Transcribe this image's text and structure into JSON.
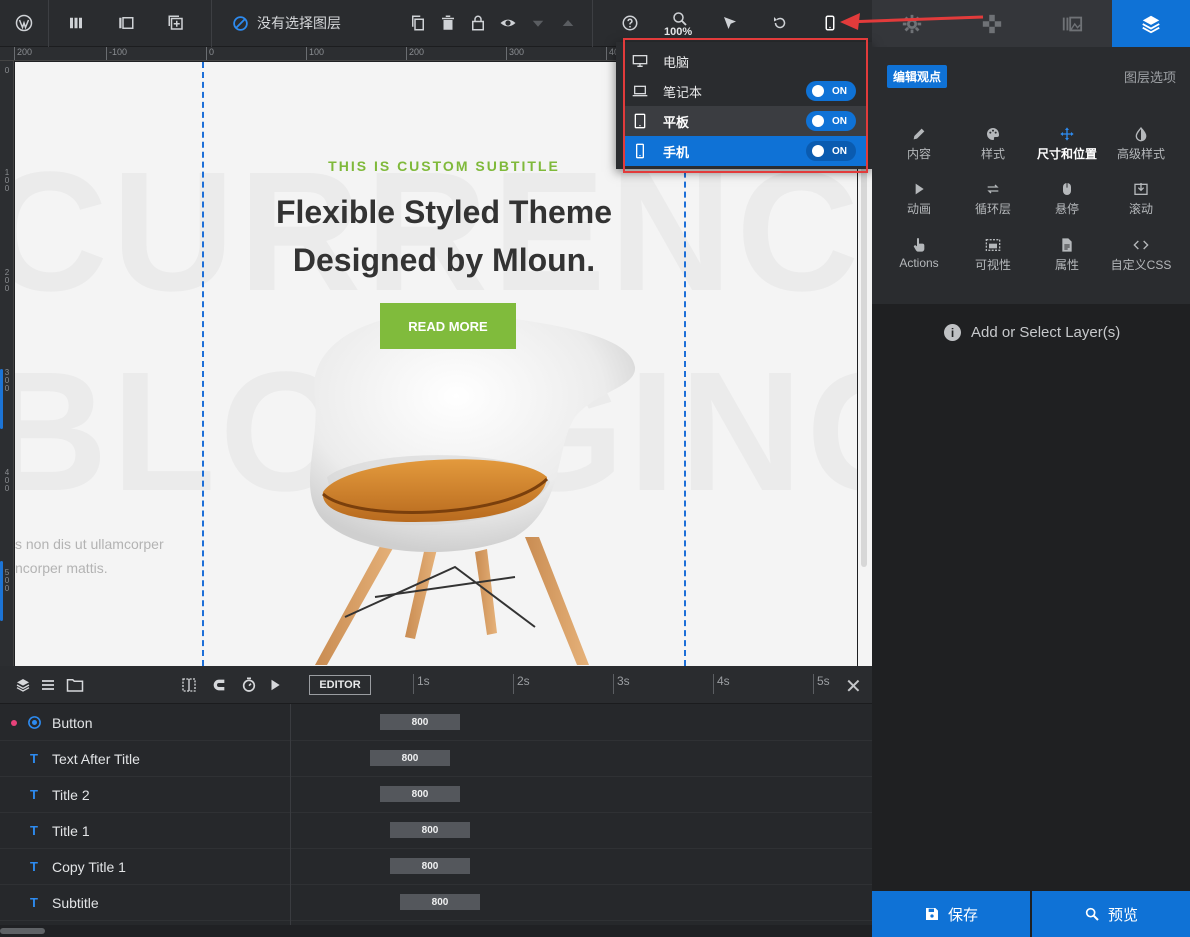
{
  "toolbar": {
    "layer_status": "没有选择图层",
    "zoom": "100%"
  },
  "ruler": {
    "h_ticks": [
      "200",
      "-100",
      "0",
      "100",
      "200",
      "300",
      "40"
    ],
    "v_ticks": [
      "0",
      "1",
      "0",
      "0",
      "2",
      "0",
      "0",
      "3",
      "0",
      "0",
      "4",
      "0",
      "0",
      "5",
      "0",
      "0"
    ]
  },
  "canvas": {
    "bg_word_1": "CURRENCY",
    "bg_word_2": "BLOGGING",
    "subtitle": "THIS IS CUSTOM SUBTITLE",
    "title_line1": "Flexible Styled Theme",
    "title_line2": "Designed by Mloun.",
    "button": "READ MORE",
    "lorem_line1": "s non dis ut ullamcorper",
    "lorem_line2": "ncorper mattis."
  },
  "device_menu": {
    "items": [
      {
        "label": "电脑",
        "icon": "desktop-icon",
        "toggle": ""
      },
      {
        "label": "笔记本",
        "icon": "laptop-icon",
        "toggle": "ON"
      },
      {
        "label": "平板",
        "icon": "tablet-icon",
        "toggle": "ON"
      },
      {
        "label": "手机",
        "icon": "mobile-icon",
        "toggle": "ON"
      }
    ]
  },
  "right_panel": {
    "badge": "编辑观点",
    "options_title": "图层选项",
    "items": [
      {
        "label": "内容",
        "icon": "pencil-icon"
      },
      {
        "label": "样式",
        "icon": "palette-icon"
      },
      {
        "label": "尺寸和位置",
        "icon": "move-icon"
      },
      {
        "label": "高级样式",
        "icon": "contrast-icon"
      },
      {
        "label": "动画",
        "icon": "play-icon"
      },
      {
        "label": "循环层",
        "icon": "loop-icon"
      },
      {
        "label": "悬停",
        "icon": "mouse-icon"
      },
      {
        "label": "滚动",
        "icon": "scroll-icon"
      },
      {
        "label": "Actions",
        "icon": "pointer-icon"
      },
      {
        "label": "可视性",
        "icon": "visibility-icon"
      },
      {
        "label": "属性",
        "icon": "document-icon"
      },
      {
        "label": "自定义CSS",
        "icon": "code-icon"
      }
    ],
    "hint": "Add or Select Layer(s)",
    "save": "保存",
    "preview": "预览"
  },
  "timeline": {
    "editor_label": "EDITOR",
    "seconds": [
      "1s",
      "2s",
      "3s",
      "4s",
      "5s"
    ],
    "layers": [
      {
        "name": "Button",
        "duration": "800",
        "type": "button"
      },
      {
        "name": "Text After Title",
        "duration": "800",
        "type": "T"
      },
      {
        "name": "Title 2",
        "duration": "800",
        "type": "T"
      },
      {
        "name": "Title 1",
        "duration": "800",
        "type": "T"
      },
      {
        "name": "Copy Title 1",
        "duration": "800",
        "type": "T"
      },
      {
        "name": "Subtitle",
        "duration": "800",
        "type": "T"
      }
    ]
  }
}
